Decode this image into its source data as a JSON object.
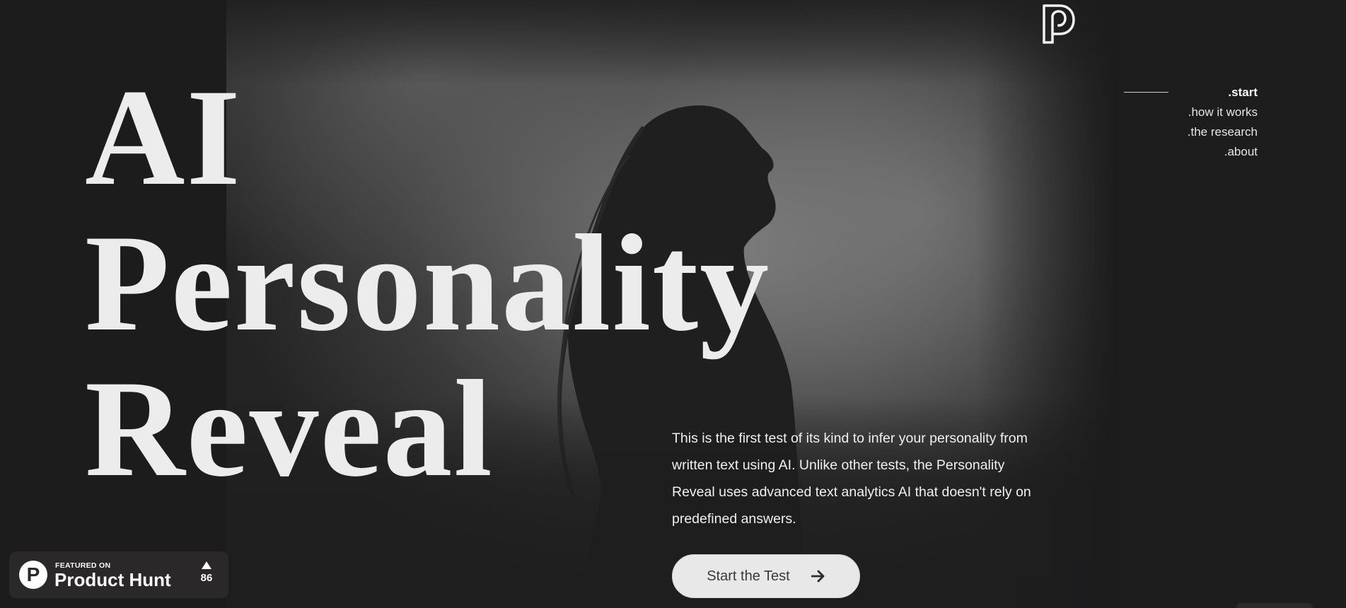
{
  "hero": {
    "title_lines": [
      "AI",
      "Personality",
      "Reveal"
    ],
    "intro": "This is the first test of its kind to infer your personality from written text using AI. Unlike other tests, the Personality Reveal uses advanced text analytics AI that doesn't rely on predefined answers.",
    "cta_label": "Start the Test"
  },
  "nav": {
    "items": [
      {
        "label": ".start",
        "active": true
      },
      {
        "label": ".how it works",
        "active": false
      },
      {
        "label": ".the research",
        "active": false
      },
      {
        "label": ".about",
        "active": false
      }
    ]
  },
  "product_hunt": {
    "kicker": "FEATURED ON",
    "name": "Product Hunt",
    "logo_letter": "P",
    "upvotes": "86"
  },
  "icons": {
    "logo": "personality-reveal-logo-icon",
    "cta": "arrow-right-icon",
    "upvote": "upvote-triangle-icon"
  },
  "colors": {
    "background": "#1c1c1d",
    "headline": "#ececec",
    "button_bg": "#e8e8e8",
    "button_text": "#3a3a3a",
    "badge_bg": "#2a2828"
  }
}
